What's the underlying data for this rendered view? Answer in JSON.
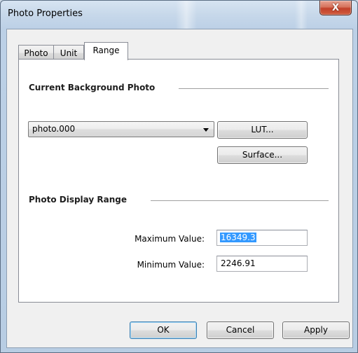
{
  "window": {
    "title": "Photo Properties",
    "close_glyph": "X"
  },
  "tabs": [
    {
      "label": "Photo",
      "active": false
    },
    {
      "label": "Unit",
      "active": false
    },
    {
      "label": "Range",
      "active": true
    }
  ],
  "range_tab": {
    "background_section_title": "Current Background Photo",
    "photo_select": {
      "value": "photo.000"
    },
    "lut_button": "LUT...",
    "surface_button": "Surface...",
    "display_range_section_title": "Photo Display Range",
    "maximum": {
      "label": "Maximum Value:",
      "value": "16349.3"
    },
    "minimum": {
      "label": "Minimum Value:",
      "value": "2246.91"
    }
  },
  "footer": {
    "ok": "OK",
    "cancel": "Cancel",
    "apply": "Apply"
  },
  "colors": {
    "close_button": "#c2412a",
    "selection_highlight": "#3399ff",
    "default_button_border": "#3c7fb1"
  },
  "icons": {
    "close": "close-icon",
    "dropdown": "chevron-down-icon"
  }
}
